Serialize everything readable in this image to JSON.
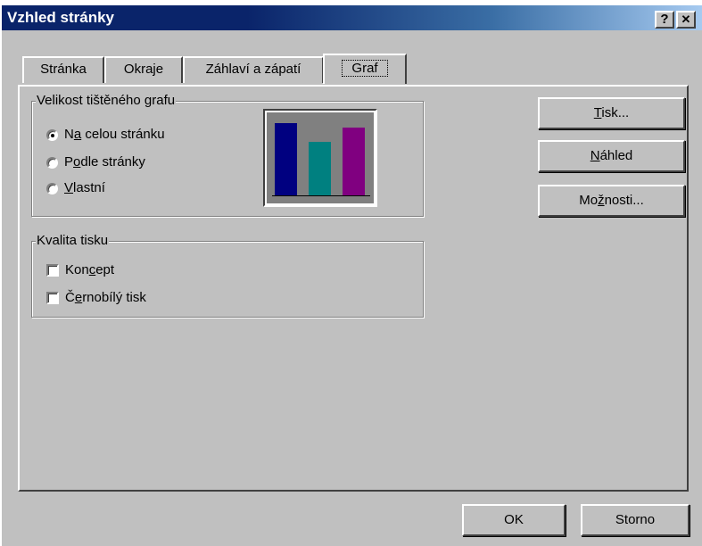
{
  "window": {
    "title": "Vzhled stránky",
    "help_glyph": "?",
    "close_glyph": "✕"
  },
  "tabs": [
    {
      "label": "Stránka",
      "active": false
    },
    {
      "label": "Okraje",
      "active": false
    },
    {
      "label": "Záhlaví a zápatí",
      "active": false
    },
    {
      "label": "Graf",
      "active": true
    }
  ],
  "size_group": {
    "legend": "Velikost tištěného grafu",
    "options": [
      {
        "pre": "N",
        "u": "a",
        "post": " celou stránku",
        "selected": true
      },
      {
        "pre": "P",
        "u": "o",
        "post": "dle stránky",
        "selected": false
      },
      {
        "pre": "",
        "u": "V",
        "post": "lastní",
        "selected": false
      }
    ]
  },
  "quality_group": {
    "legend": "Kvalita tisku",
    "options": [
      {
        "pre": "Kon",
        "u": "c",
        "post": "ept",
        "checked": false
      },
      {
        "pre": "Č",
        "u": "e",
        "post": "rnobílý tisk",
        "checked": false
      }
    ]
  },
  "preview_bars": [
    {
      "relative_height": 0.92,
      "color": "#000080"
    },
    {
      "relative_height": 0.68,
      "color": "#008080"
    },
    {
      "relative_height": 0.86,
      "color": "#800080"
    }
  ],
  "side_buttons": [
    {
      "pre": "",
      "u": "T",
      "post": "isk..."
    },
    {
      "pre": "",
      "u": "N",
      "post": "áhled"
    },
    {
      "pre": "Mo",
      "u": "ž",
      "post": "nosti..."
    }
  ],
  "footer": {
    "ok_label": "OK",
    "cancel_label": "Storno"
  }
}
